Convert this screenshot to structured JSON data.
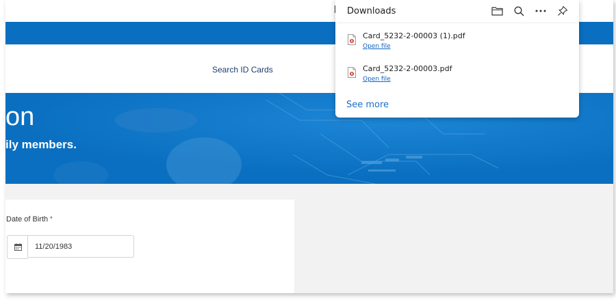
{
  "page": {
    "nav_link": "Search ID Cards",
    "hero_title": "on",
    "hero_subtitle": "ily members."
  },
  "form": {
    "dob_label": "Date of Birth",
    "required_mark": "*",
    "dob_value": "11/20/1983"
  },
  "downloads": {
    "title": "Downloads",
    "icons": [
      "folder-icon",
      "search-icon",
      "more-icon",
      "pin-icon"
    ],
    "items": [
      {
        "filename": "Card_5232-2-00003 (1).pdf",
        "action": "Open file"
      },
      {
        "filename": "Card_5232-2-00003.pdf",
        "action": "Open file"
      }
    ],
    "see_more": "See more"
  },
  "colors": {
    "brand_blue": "#0a6fc0",
    "link_blue": "#0a62c3",
    "nav_text": "#1a3d6d"
  }
}
